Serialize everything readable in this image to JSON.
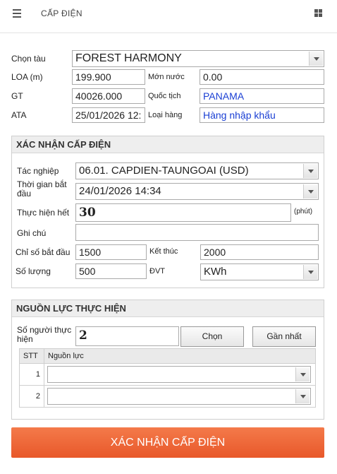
{
  "header": {
    "title": "CẤP ĐIỆN"
  },
  "vessel": {
    "labels": {
      "ship": "Chọn tàu",
      "loa": "LOA (m)",
      "draft": "Mớn nước",
      "gt": "GT",
      "nationality": "Quốc tịch",
      "ata": "ATA",
      "cargo": "Loại hàng"
    },
    "ship": "FOREST HARMONY",
    "loa": "199.900",
    "draft": "0.00",
    "gt": "40026.000",
    "nationality": "PANAMA",
    "ata": "25/01/2026 12:",
    "cargo": "Hàng nhập khẩu"
  },
  "confirm": {
    "title": "XÁC NHẬN CẤP ĐIỆN",
    "labels": {
      "operation": "Tác nghiệp",
      "start_time_1": "Thời gian bắt",
      "start_time_2": "đầu",
      "duration": "Thực hiện hết",
      "duration_unit": "(phút)",
      "note": "Ghi chú",
      "start_index": "Chỉ số bắt đầu",
      "end_index": "Kết thúc",
      "quantity": "Số lượng",
      "unit": "ĐVT"
    },
    "operation": "06.01. CAPDIEN-TAUNGOAI (USD)",
    "start_time": "24/01/2026 14:34",
    "duration": "30",
    "note": "",
    "start_index": "1500",
    "end_index": "2000",
    "quantity": "500",
    "unit": "KWh"
  },
  "resources": {
    "title": "NGUỒN LỰC THỰC HIỆN",
    "labels": {
      "count_1": "Số người thực",
      "count_2": "hiện"
    },
    "count": "2",
    "choose_button": "Chọn",
    "recent_button": "Gần nhất",
    "table": {
      "col_stt": "STT",
      "col_resource": "Nguồn lực",
      "rows": [
        {
          "stt": "1",
          "value": ""
        },
        {
          "stt": "2",
          "value": ""
        }
      ]
    }
  },
  "submit_button": "XÁC NHẬN CẤP ĐIỆN"
}
